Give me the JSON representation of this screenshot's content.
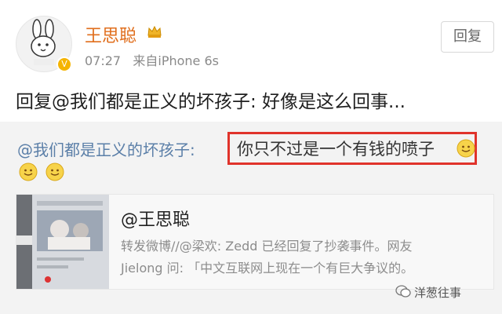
{
  "post": {
    "username": "王思聪",
    "time": "07:27",
    "source": "来自iPhone 6s",
    "reply_button": "回复",
    "text": "回复@我们都是正义的坏孩子: 好像是这么回事..."
  },
  "quote": {
    "mention": "@我们都是正义的坏孩子:",
    "highlighted_text": "你只不过是一个有钱的喷子"
  },
  "card": {
    "title": "@王思聪",
    "line1": "转发微博//@梁欢: Zedd 已经回复了抄袭事件。网友",
    "line2": "Jielong 问: 「中文互联网上现在一个有巨大争议的。"
  },
  "watermark": {
    "text": "洋葱往事"
  },
  "colors": {
    "username": "#e06e1c",
    "highlight_border": "#e0332b",
    "mention": "#5b7fa8"
  }
}
